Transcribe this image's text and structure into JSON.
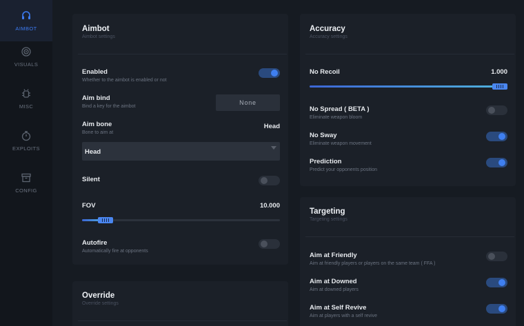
{
  "sidebar": {
    "items": [
      {
        "label": "AIMBOT",
        "icon": "headset-icon",
        "active": true
      },
      {
        "label": "VISUALS",
        "icon": "eye-target-icon",
        "active": false
      },
      {
        "label": "MISC",
        "icon": "gear-bug-icon",
        "active": false
      },
      {
        "label": "EXPLOITS",
        "icon": "stopwatch-icon",
        "active": false
      },
      {
        "label": "CONFIG",
        "icon": "archive-box-icon",
        "active": false
      }
    ]
  },
  "aimbot": {
    "title": "Aimbot",
    "subtitle": "Aimbot settings",
    "enabled": {
      "label": "Enabled",
      "desc": "Whether to the aimbot is enabled or not",
      "on": true
    },
    "aim_bind": {
      "label": "Aim bind",
      "desc": "Bind a key for the aimbot",
      "button": "None"
    },
    "aim_bone": {
      "label": "Aim bone",
      "desc": "Bone to aim at",
      "value": "Head",
      "selected": "Head"
    },
    "silent": {
      "label": "Silent",
      "on": false
    },
    "fov": {
      "label": "FOV",
      "value": "10.000",
      "fraction": 0.12
    },
    "autofire": {
      "label": "Autofire",
      "desc": "Automatically fire at opponents",
      "on": false
    }
  },
  "override": {
    "title": "Override",
    "subtitle": "Override settings"
  },
  "accuracy": {
    "title": "Accuracy",
    "subtitle": "Accuracy settings",
    "no_recoil": {
      "label": "No Recoil",
      "value": "1.000",
      "fraction": 1.0
    },
    "no_spread": {
      "label": "No Spread ( BETA )",
      "desc": "Eliminate weapon bloom",
      "on": false
    },
    "no_sway": {
      "label": "No Sway",
      "desc": "Eliminate weapon movement",
      "on": true
    },
    "prediction": {
      "label": "Prediction",
      "desc": "Predict your opponents position",
      "on": true
    }
  },
  "targeting": {
    "title": "Targeting",
    "subtitle": "Targeting settings",
    "aim_friendly": {
      "label": "Aim at Friendly",
      "desc": "Aim at friendly players or players on the same team ( FFA )",
      "on": false
    },
    "aim_downed": {
      "label": "Aim at Downed",
      "desc": "Aim at downed players",
      "on": true
    },
    "aim_self_revive": {
      "label": "Aim at Self Revive",
      "desc": "Aim at players with a self revive",
      "on": true
    }
  },
  "colors": {
    "accent": "#3f7ff0",
    "background": "#161b22",
    "panel": "#1b2028"
  }
}
